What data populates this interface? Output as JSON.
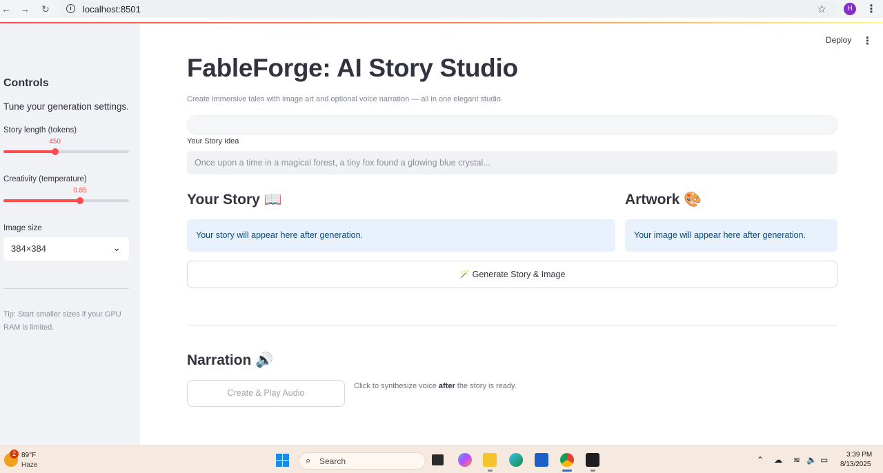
{
  "browser": {
    "url": "localhost:8501",
    "profile_initial": "H"
  },
  "sidebar": {
    "title": "Controls",
    "subtitle": "Tune your generation settings.",
    "story_length": {
      "label": "Story length (tokens)",
      "value": "450",
      "fraction": 0.41
    },
    "creativity": {
      "label": "Creativity (temperature)",
      "value": "0.85",
      "fraction": 0.61
    },
    "image_size": {
      "label": "Image size",
      "value": "384×384"
    },
    "tip": "Tip: Start smaller sizes if your GPU RAM is limited."
  },
  "header": {
    "deploy_label": "Deploy"
  },
  "main": {
    "title": "FableForge: AI Story Studio",
    "subtitle": "Create immersive tales with image art and optional voice narration — all in one elegant studio.",
    "idea_label": "Your Story Idea",
    "idea_placeholder": "Once upon a time in a magical forest, a tiny fox found a glowing blue crystal...",
    "story_heading": "Your Story 📖",
    "story_placeholder": "Your story will appear here after generation.",
    "artwork_heading": "Artwork 🎨",
    "artwork_placeholder": "Your image will appear here after generation.",
    "generate_button": "🪄 Generate Story & Image",
    "narration_heading": "Narration 🔊",
    "audio_button": "Create & Play Audio",
    "audio_hint_pre": "Click to synthesize voice ",
    "audio_hint_bold": "after",
    "audio_hint_post": " the story is ready."
  },
  "taskbar": {
    "weather_temp": "89°F",
    "weather_desc": "Haze",
    "weather_badge": "2",
    "search_label": "Search",
    "time": "3:39 PM",
    "date": "8/13/2025"
  },
  "colors": {
    "accent": "#ff4b4b",
    "info_bg": "#e8f1fc",
    "sidebar_bg": "#f0f2f6"
  }
}
